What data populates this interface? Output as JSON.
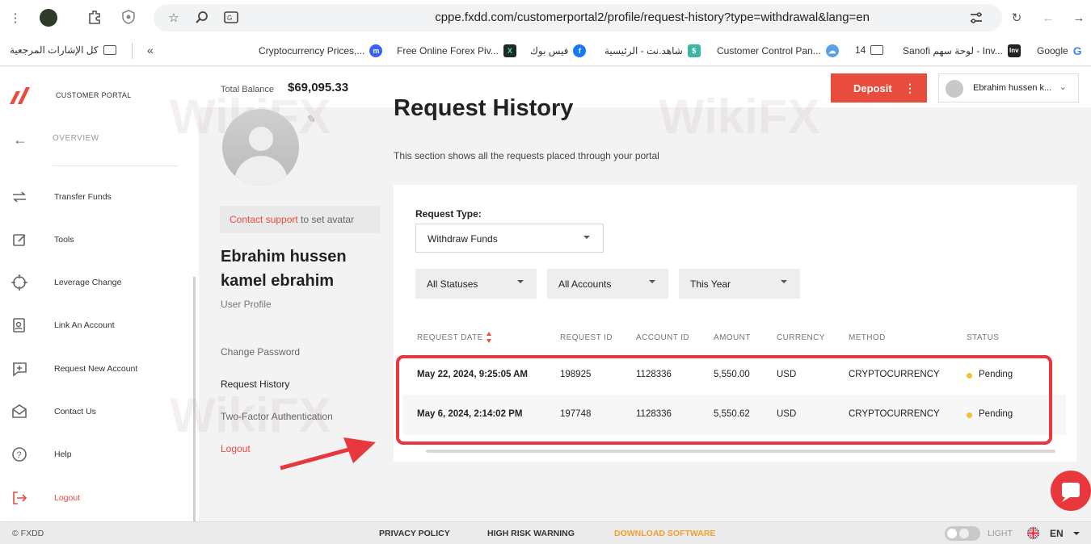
{
  "browser": {
    "url": "cppe.fxdd.com/customerportal2/profile/request-history?type=withdrawal&lang=en",
    "bookmarks": [
      {
        "label": "Google",
        "icon": "google-icon",
        "color": "#4285f4"
      },
      {
        "label": "Sanofi لوحة سهم - Inv...",
        "icon": "investing-icon",
        "color": "#222222"
      },
      {
        "label": "14",
        "icon": "folder-icon",
        "color": "#555555"
      },
      {
        "label": "Customer Control Pan...",
        "icon": "cloud-icon",
        "color": "#5aa0e6"
      },
      {
        "label": "شاهد.نت - الرئيسية",
        "icon": "shahid-icon",
        "color": "#3fb6a5"
      },
      {
        "label": "فيس بوك",
        "icon": "facebook-icon",
        "color": "#1877f2"
      },
      {
        "label": "Free Online Forex Piv...",
        "icon": "x-icon",
        "color": "#1e2a2a"
      },
      {
        "label": "Cryptocurrency Prices,...",
        "icon": "coinmarket-icon",
        "color": "#3861fb"
      },
      {
        "label": "كل الإشارات المرجعية",
        "icon": "folder-icon",
        "color": "#555555"
      }
    ]
  },
  "sidebar": {
    "portal_title": "CUSTOMER PORTAL",
    "overview": "OVERVIEW",
    "items": [
      {
        "label": "Transfer Funds",
        "icon": "transfer-icon"
      },
      {
        "label": "Tools",
        "icon": "edit-icon"
      },
      {
        "label": "Leverage Change",
        "icon": "crosshair-icon"
      },
      {
        "label": "Link An Account",
        "icon": "link-account-icon"
      },
      {
        "label": "Request New Account",
        "icon": "add-message-icon"
      },
      {
        "label": "Contact Us",
        "icon": "mail-icon"
      },
      {
        "label": "Help",
        "icon": "help-icon"
      },
      {
        "label": "Logout",
        "icon": "logout-icon"
      }
    ]
  },
  "header": {
    "total_balance_label": "Total Balance",
    "total_balance_value": "$69,095.33",
    "deposit_label": "Deposit",
    "user_name_short": "Ebrahim hussen k..."
  },
  "profile": {
    "contact_support_link": "Contact support",
    "contact_support_rest": " to set avatar",
    "full_name_line1": "Ebrahim hussen",
    "full_name_line2": "kamel ebrahim",
    "user_profile_label": "User Profile",
    "links": [
      {
        "label": "Change Password"
      },
      {
        "label": "Request History"
      },
      {
        "label": "Two-Factor Authentication"
      },
      {
        "label": "Logout"
      }
    ]
  },
  "main": {
    "title": "Request History",
    "description": "This section shows all the requests placed through your portal",
    "request_type_label": "Request Type:",
    "request_type_value": "Withdraw Funds",
    "filters": [
      "All Statuses",
      "All Accounts",
      "This Year"
    ],
    "columns": [
      "REQUEST DATE",
      "REQUEST ID",
      "ACCOUNT ID",
      "AMOUNT",
      "CURRENCY",
      "METHOD",
      "STATUS"
    ],
    "rows": [
      {
        "date": "May 22, 2024, 9:25:05 AM",
        "request_id": "198925",
        "account_id": "1128336",
        "amount": "5,550.00",
        "currency": "USD",
        "method": "CRYPTOCURRENCY",
        "status": "Pending"
      },
      {
        "date": "May 6, 2024, 2:14:02 PM",
        "request_id": "197748",
        "account_id": "1128336",
        "amount": "5,550.62",
        "currency": "USD",
        "method": "CRYPTOCURRENCY",
        "status": "Pending"
      }
    ],
    "status_color": "#f2c12e"
  },
  "footer": {
    "copyright": "© FXDD",
    "privacy": "PRIVACY POLICY",
    "risk": "HIGH RISK WARNING",
    "download": "DOWNLOAD SOFTWARE",
    "theme": "LIGHT",
    "lang": "EN"
  },
  "colors": {
    "accent": "#e84c3d",
    "highlight": "#e8373d"
  }
}
